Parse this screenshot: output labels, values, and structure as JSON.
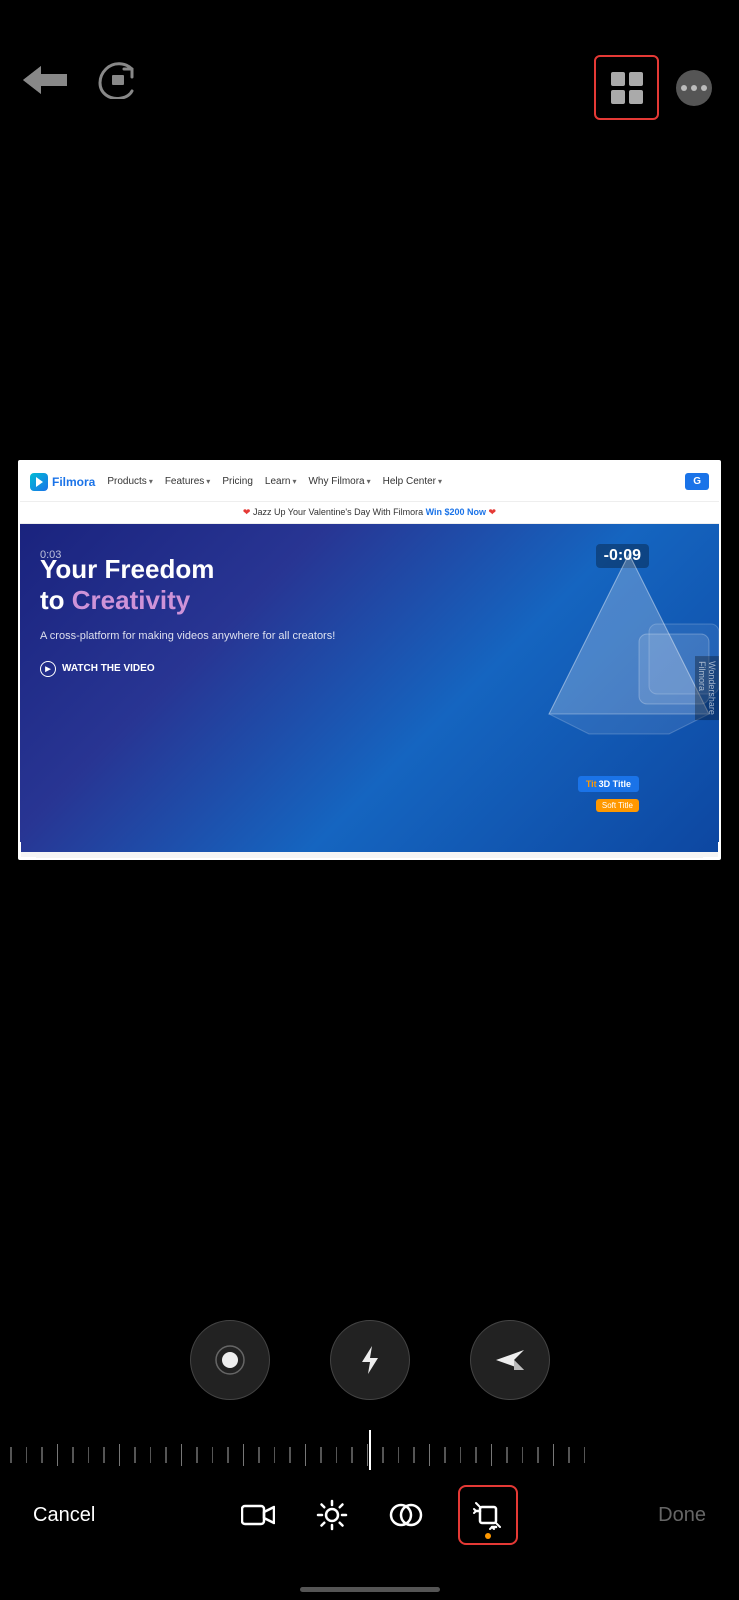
{
  "app": {
    "background": "#000000"
  },
  "top_toolbar": {
    "undo_label": "undo",
    "redo_label": "redo",
    "layout_icon_label": "layout",
    "more_icon_label": "more options"
  },
  "video_preview": {
    "website": {
      "nav": {
        "logo": "Filmora",
        "items": [
          "Products",
          "Features",
          "Pricing",
          "Learn",
          "Why Filmora",
          "Help Center"
        ],
        "cta": "G"
      },
      "promo": "❤ Jazz Up Your Valentine's Day With Filmora Win $200 Now ❤",
      "hero": {
        "title": "Your Freedom to Creativity",
        "subtitle": "A cross-platform for making videos anywhere for all creators!",
        "timer": "0:03",
        "countdown": "-0:09",
        "watch_label": "WATCH THE VIDEO",
        "tag_3d": "3D Title",
        "tag_soft": "Soft Title",
        "watermark_top": "Wondershare",
        "watermark_bottom": "Filmora"
      }
    }
  },
  "controls": {
    "round_btn_1": "record",
    "round_btn_2": "flash",
    "round_btn_3": "send"
  },
  "bottom_toolbar": {
    "cancel_label": "Cancel",
    "done_label": "Done",
    "video_icon": "video-camera",
    "brightness_icon": "brightness",
    "blend_icon": "blend",
    "crop_icon": "crop-transform"
  }
}
